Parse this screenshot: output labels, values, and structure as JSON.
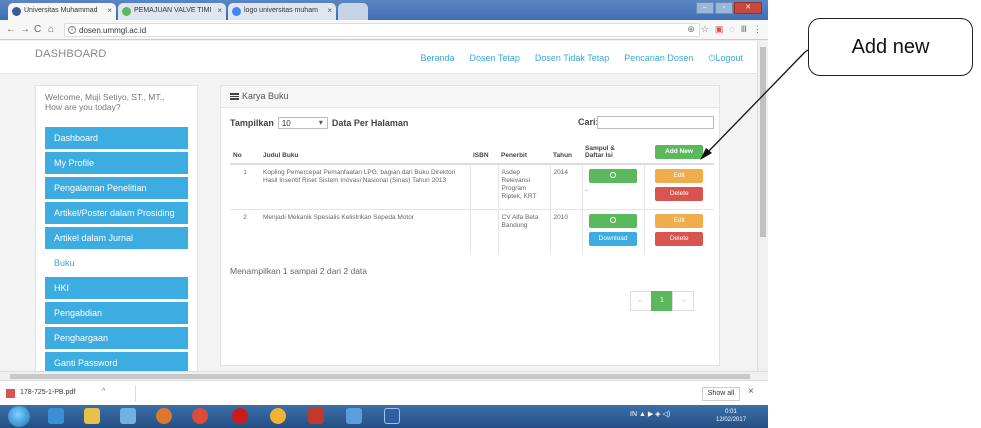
{
  "browser": {
    "tabs": [
      {
        "title": "Universitas Muhammad",
        "color": "#3b5998"
      },
      {
        "title": "PEMAJUAN VALVE TIMI",
        "color": "#5cb85c"
      },
      {
        "title": "logo universitas muham",
        "color": "#4285f4"
      }
    ],
    "url": "dosen.ummgl.ac.id",
    "back_glyph": "←",
    "forward_glyph": "→",
    "reload_glyph": "C",
    "home_glyph": "⌂",
    "ext_icons": [
      "⊕",
      "☆",
      "▣",
      "◌",
      "Ⅲ",
      "⋮"
    ]
  },
  "site": {
    "brand": "DASHBOARD",
    "nav": [
      "Beranda",
      "Dosen Tetap",
      "Dosen Tidak Tetap",
      "Pencarian Dosen",
      "Logout"
    ],
    "logout_icon": "⏻"
  },
  "sidebar": {
    "welcome": "Welcome, Muji Setiyo, ST., MT.,",
    "welcome_sub": "How are you today?",
    "items": [
      {
        "label": "Dashboard"
      },
      {
        "label": "My Profile"
      },
      {
        "label": "Pengalaman Penelitian"
      },
      {
        "label": "Artikel/Poster dalam Prosiding"
      },
      {
        "label": "Artikel dalam Jurnal"
      },
      {
        "label": "Buku"
      },
      {
        "label": "HKI"
      },
      {
        "label": "Pengabdian"
      },
      {
        "label": "Penghargaan"
      },
      {
        "label": "Ganti Password"
      }
    ]
  },
  "main": {
    "panel_title": "Karya Buku",
    "show_label": "Tampilkan",
    "show_value": "10",
    "per_page_label": "Data Per Halaman",
    "search_label": "Cari:",
    "columns": {
      "no": "No",
      "judul": "Judul Buku",
      "isbn": "ISBN",
      "penerbit": "Penerbit",
      "tahun": "Tahun",
      "sampul": "Sampul &",
      "sampul2": "Daftar Isi",
      "add": "Add New"
    },
    "rows": [
      {
        "no": "1",
        "judul": "Kopling Pemercepat Pemanfaatan LPG, bagian dari Buku Direktori Hasil Insentif Riset Sistem Inovasi Nasional (Sinas) Tahun 2013",
        "isbn": "",
        "penerbit": "Asdep Relevansi Program Riptek, KRT",
        "tahun": "2014",
        "extra": "-",
        "edit": "Edit",
        "delete": "Delete"
      },
      {
        "no": "2",
        "judul": "Menjadi Mekanik Spesialis Kelistrikan Sepeda Motor",
        "isbn": "",
        "penerbit": "CV Alfa Beta Bandung",
        "tahun": "2010",
        "download": "Download",
        "edit": "Edit",
        "delete": "Delete"
      }
    ],
    "showing": "Menampilkan 1 sampai 2 dari 2 data",
    "pager": [
      "←",
      "1",
      "→"
    ]
  },
  "downloads": {
    "file": "178-725-1-PB.pdf",
    "caret": "^",
    "show_all": "Show all",
    "close": "×"
  },
  "taskbar": {
    "tray": "IN ▲ ▶ ◈ ◁)",
    "time": "0:01",
    "date": "12/02/2017"
  },
  "annotation": {
    "label": "Add new"
  }
}
